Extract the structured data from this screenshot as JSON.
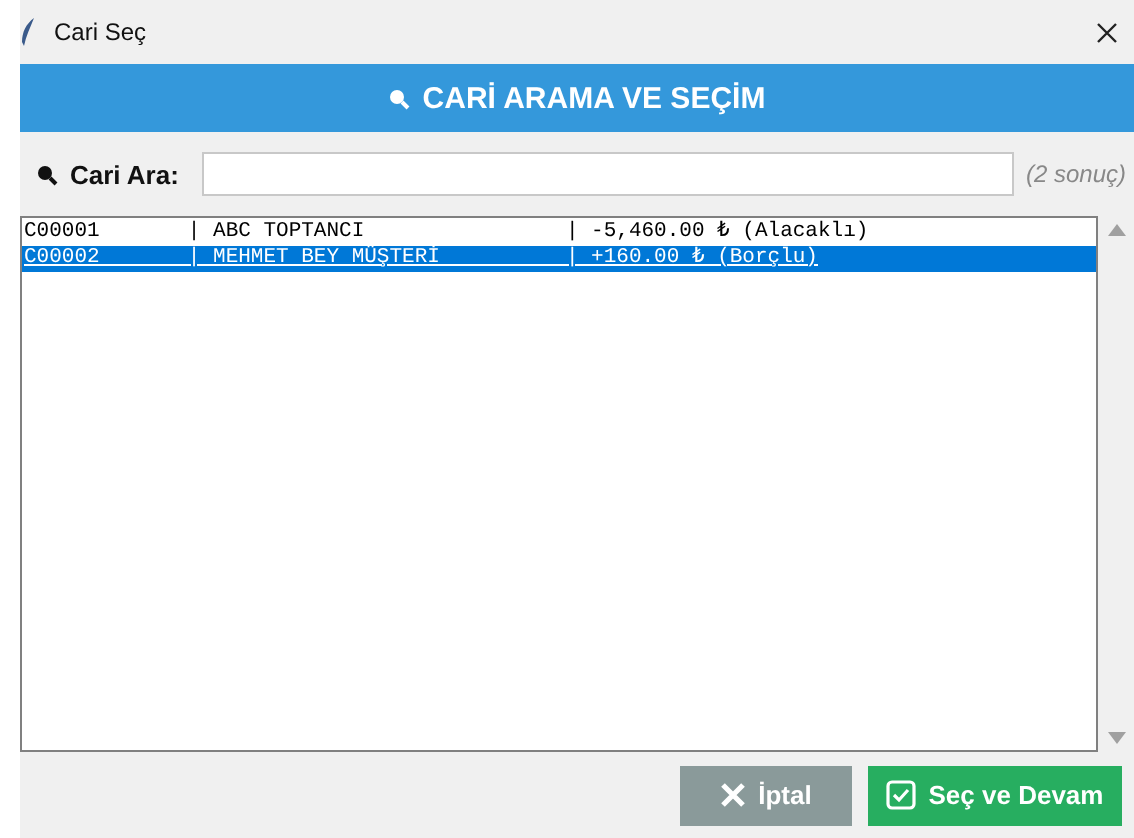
{
  "window": {
    "title": "Cari Seç"
  },
  "header": {
    "title": "CARİ ARAMA VE SEÇİM"
  },
  "search": {
    "label": "Cari Ara:",
    "result_count": "(2 sonuç)"
  },
  "list": {
    "rows": [
      {
        "text": "C00001       | ABC TOPTANCI                | -5,460.00 ₺ (Alacaklı)",
        "selected": false
      },
      {
        "text": "C00002       | MEHMET BEY MÜŞTERİ          | +160.00 ₺ (Borçlu)",
        "selected": true
      }
    ]
  },
  "buttons": [
    {
      "label": "İptal",
      "kind": "cancel"
    },
    {
      "label": "Seç ve Devam",
      "kind": "confirm"
    }
  ]
}
